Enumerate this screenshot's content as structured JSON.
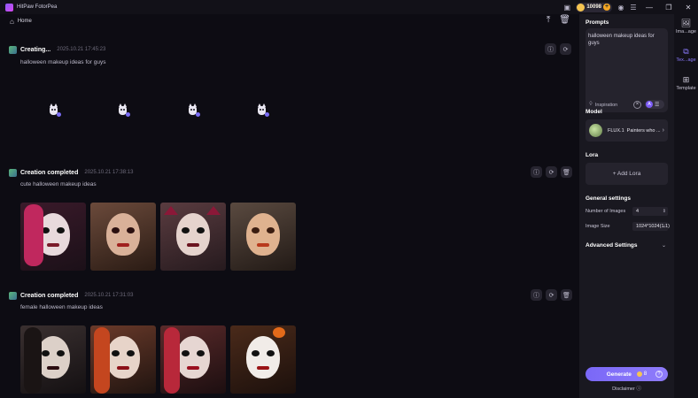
{
  "app": {
    "title": "HitPaw FotorPea",
    "credits": "10098"
  },
  "nav": {
    "home_label": "Home"
  },
  "sections": [
    {
      "status": "Creating...",
      "time": "2025.10.21  17:45:23",
      "prompt": "halloween makeup ideas for guys"
    },
    {
      "status": "Creation completed",
      "time": "2025.10.21  17:38:13",
      "prompt": "cute halloween makeup ideas"
    },
    {
      "status": "Creation completed",
      "time": "2025.10.21  17:31:03",
      "prompt": "female halloween makeup ideas"
    }
  ],
  "panel": {
    "prompts_label": "Prompts",
    "prompt_text": "halloween makeup ideas for guys",
    "inspiration_label": "Inspiration",
    "model_label": "Model",
    "model_name": "FLUX.1",
    "model_sub": "Painters who ...",
    "lora_label": "Lora",
    "add_lora_label": "+ Add Lora",
    "general_label": "General settings",
    "num_images_key": "Number of Images",
    "num_images_val": "4",
    "image_size_key": "Image Size",
    "image_size_val": "1024*1024(1:1)",
    "advanced_label": "Advanced Settings",
    "generate_label": "Generate",
    "generate_cost": "8",
    "disclaimer": "Disclaimer"
  },
  "tabs": [
    {
      "label": "Ima...age",
      "icon": "image-icon"
    },
    {
      "label": "Tex...age",
      "icon": "text-image-icon"
    },
    {
      "label": "Template",
      "icon": "template-icon"
    }
  ],
  "colors": {
    "accent": "#7c6cf6",
    "bg": "#0d0c13",
    "panel": "#191820"
  }
}
